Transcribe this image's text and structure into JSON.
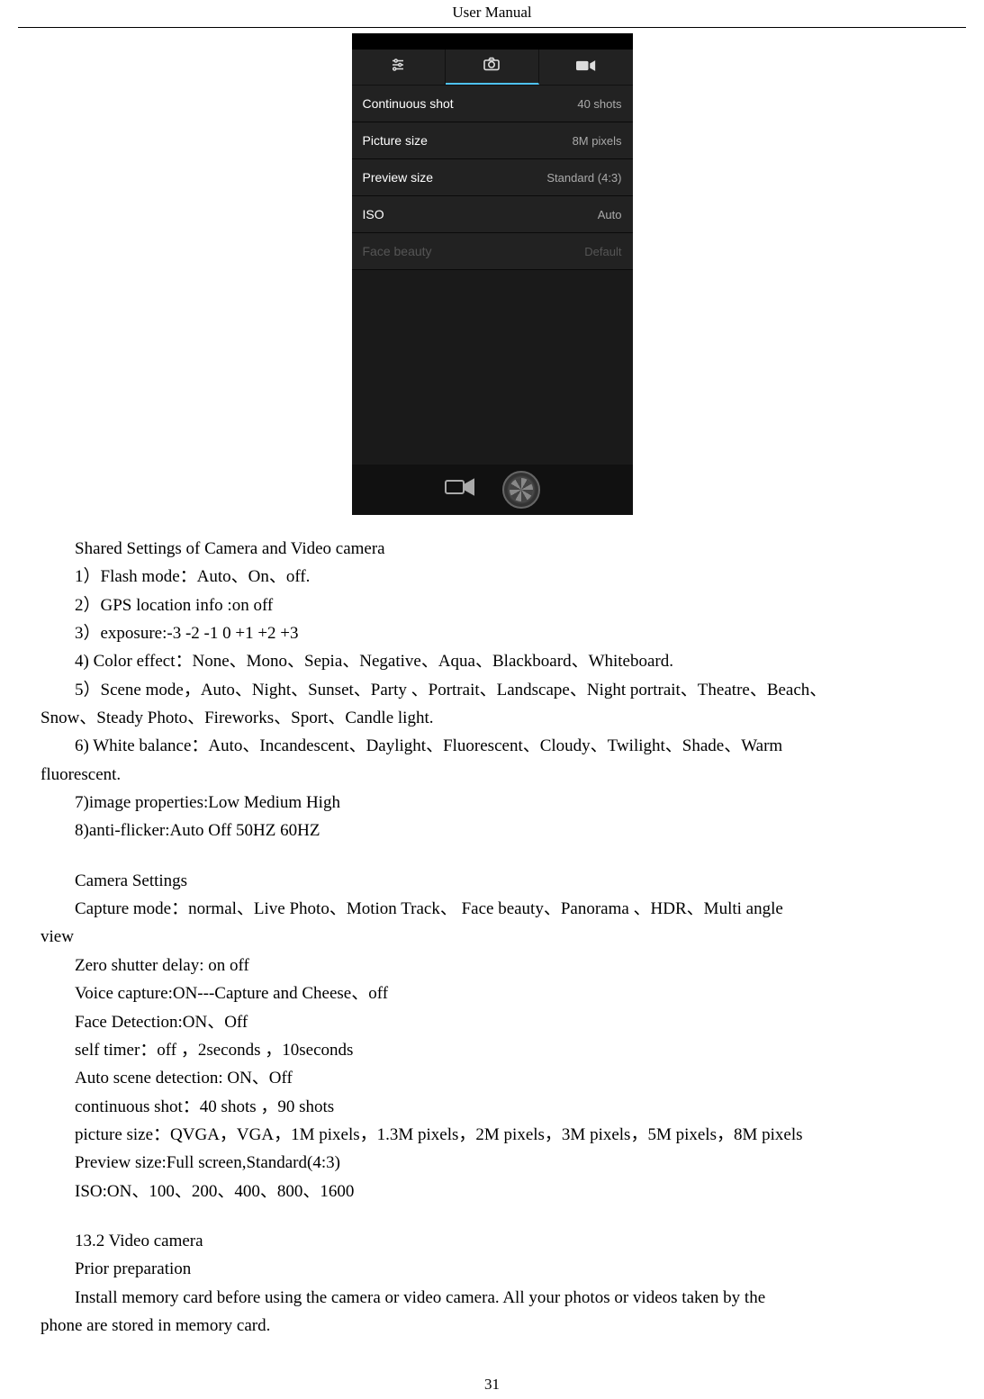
{
  "header": "User    Manual",
  "page_number": "31",
  "screenshot": {
    "status_time": "",
    "tabs": {
      "settings": "⚙",
      "image": "▦",
      "video": "■▸"
    },
    "rows": [
      {
        "label": "Continuous shot",
        "value": "40 shots"
      },
      {
        "label": "Picture size",
        "value": "8M pixels"
      },
      {
        "label": "Preview size",
        "value": "Standard (4:3)"
      },
      {
        "label": "ISO",
        "value": "Auto"
      },
      {
        "label": "Face beauty",
        "value": "Default"
      }
    ]
  },
  "body": {
    "shared_title": "Shared Settings of Camera and Video camera",
    "l1": "1）Flash mode：Auto、On、off.",
    "l2": " 2）GPS location info :on      off",
    "l3": "3）exposure:-3    -2    -1    0    +1    +2    +3",
    "l4": "4)    Color effect：None、Mono、Sepia、Negative、Aqua、Blackboard、Whiteboard.",
    "l5a": "5）Scene mode，Auto、Night、Sunset、Party 、Portrait、Landscape、Night portrait、Theatre、Beach、",
    "l5b": "Snow、Steady Photo、Fireworks、Sport、Candle light.",
    "l6a": "6) White balance：Auto、Incandescent、Daylight、Fluorescent、Cloudy、Twilight、Shade、Warm",
    "l6b": "fluorescent.",
    "l7": "7)image properties:Low    Medium    High",
    "l8": "8)anti-flicker:Auto    Off    50HZ    60HZ",
    "cam_title": "Camera Settings",
    "c1a": "Capture mode：normal、Live Photo、Motion Track、  Face beauty、Panorama    、HDR、Multi angle",
    "c1b": "view",
    "c2": "Zero shutter delay: on    off",
    "c3": "Voice capture:ON---Capture and Cheese、off",
    "c4": "Face Detection:ON、Off",
    "c5": "self timer：off  ，2seconds  ，10seconds",
    "c6": "Auto scene detection: ON、Off",
    "c7": "continuous shot：40 shots ，90 shots",
    "c8": "picture size：QVGA，VGA，1M pixels，1.3M pixels，2M pixels，3M pixels，5M pixels，8M pixels",
    "c9": "Preview size:Full screen,Standard(4:3)",
    "c10": "ISO:ON、100、200、400、800、1600",
    "sec132": "13.2    Video camera",
    "prep_title": "Prior preparation",
    "prep_body_a": "Install memory card before using the camera or video camera. All your photos or videos taken by the",
    "prep_body_b": "phone are stored in memory card."
  }
}
